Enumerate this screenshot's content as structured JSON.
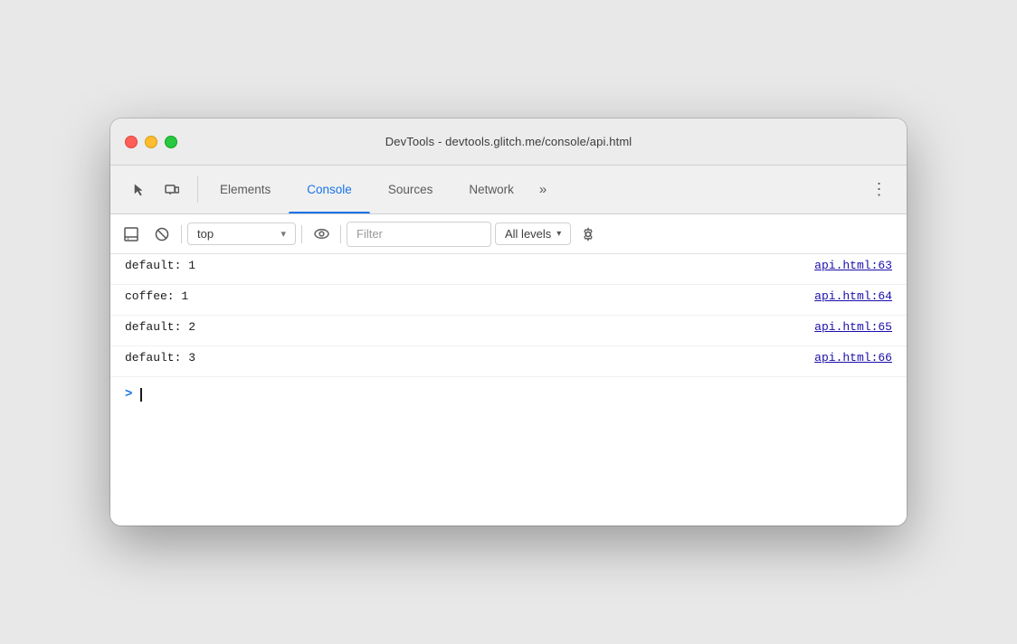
{
  "window": {
    "title": "DevTools - devtools.glitch.me/console/api.html"
  },
  "tabs": {
    "items": [
      {
        "id": "elements",
        "label": "Elements",
        "active": false
      },
      {
        "id": "console",
        "label": "Console",
        "active": true
      },
      {
        "id": "sources",
        "label": "Sources",
        "active": false
      },
      {
        "id": "network",
        "label": "Network",
        "active": false
      }
    ],
    "more_label": "»"
  },
  "console_toolbar": {
    "context_value": "top",
    "filter_placeholder": "Filter",
    "levels_label": "All levels"
  },
  "console_rows": [
    {
      "message": "default: 1",
      "link": "api.html:63"
    },
    {
      "message": "coffee: 1",
      "link": "api.html:64"
    },
    {
      "message": "default: 2",
      "link": "api.html:65"
    },
    {
      "message": "default: 3",
      "link": "api.html:66"
    }
  ],
  "icons": {
    "cursor": "▶",
    "pointer_icon": "⬡",
    "inspect_icon": "⬡",
    "toggle_drawer": "▣",
    "clear_console": "🚫",
    "eye_icon": "👁",
    "gear_icon": "⚙",
    "kebab": "⋮",
    "chevron_down": "▾",
    "prompt": ">"
  }
}
